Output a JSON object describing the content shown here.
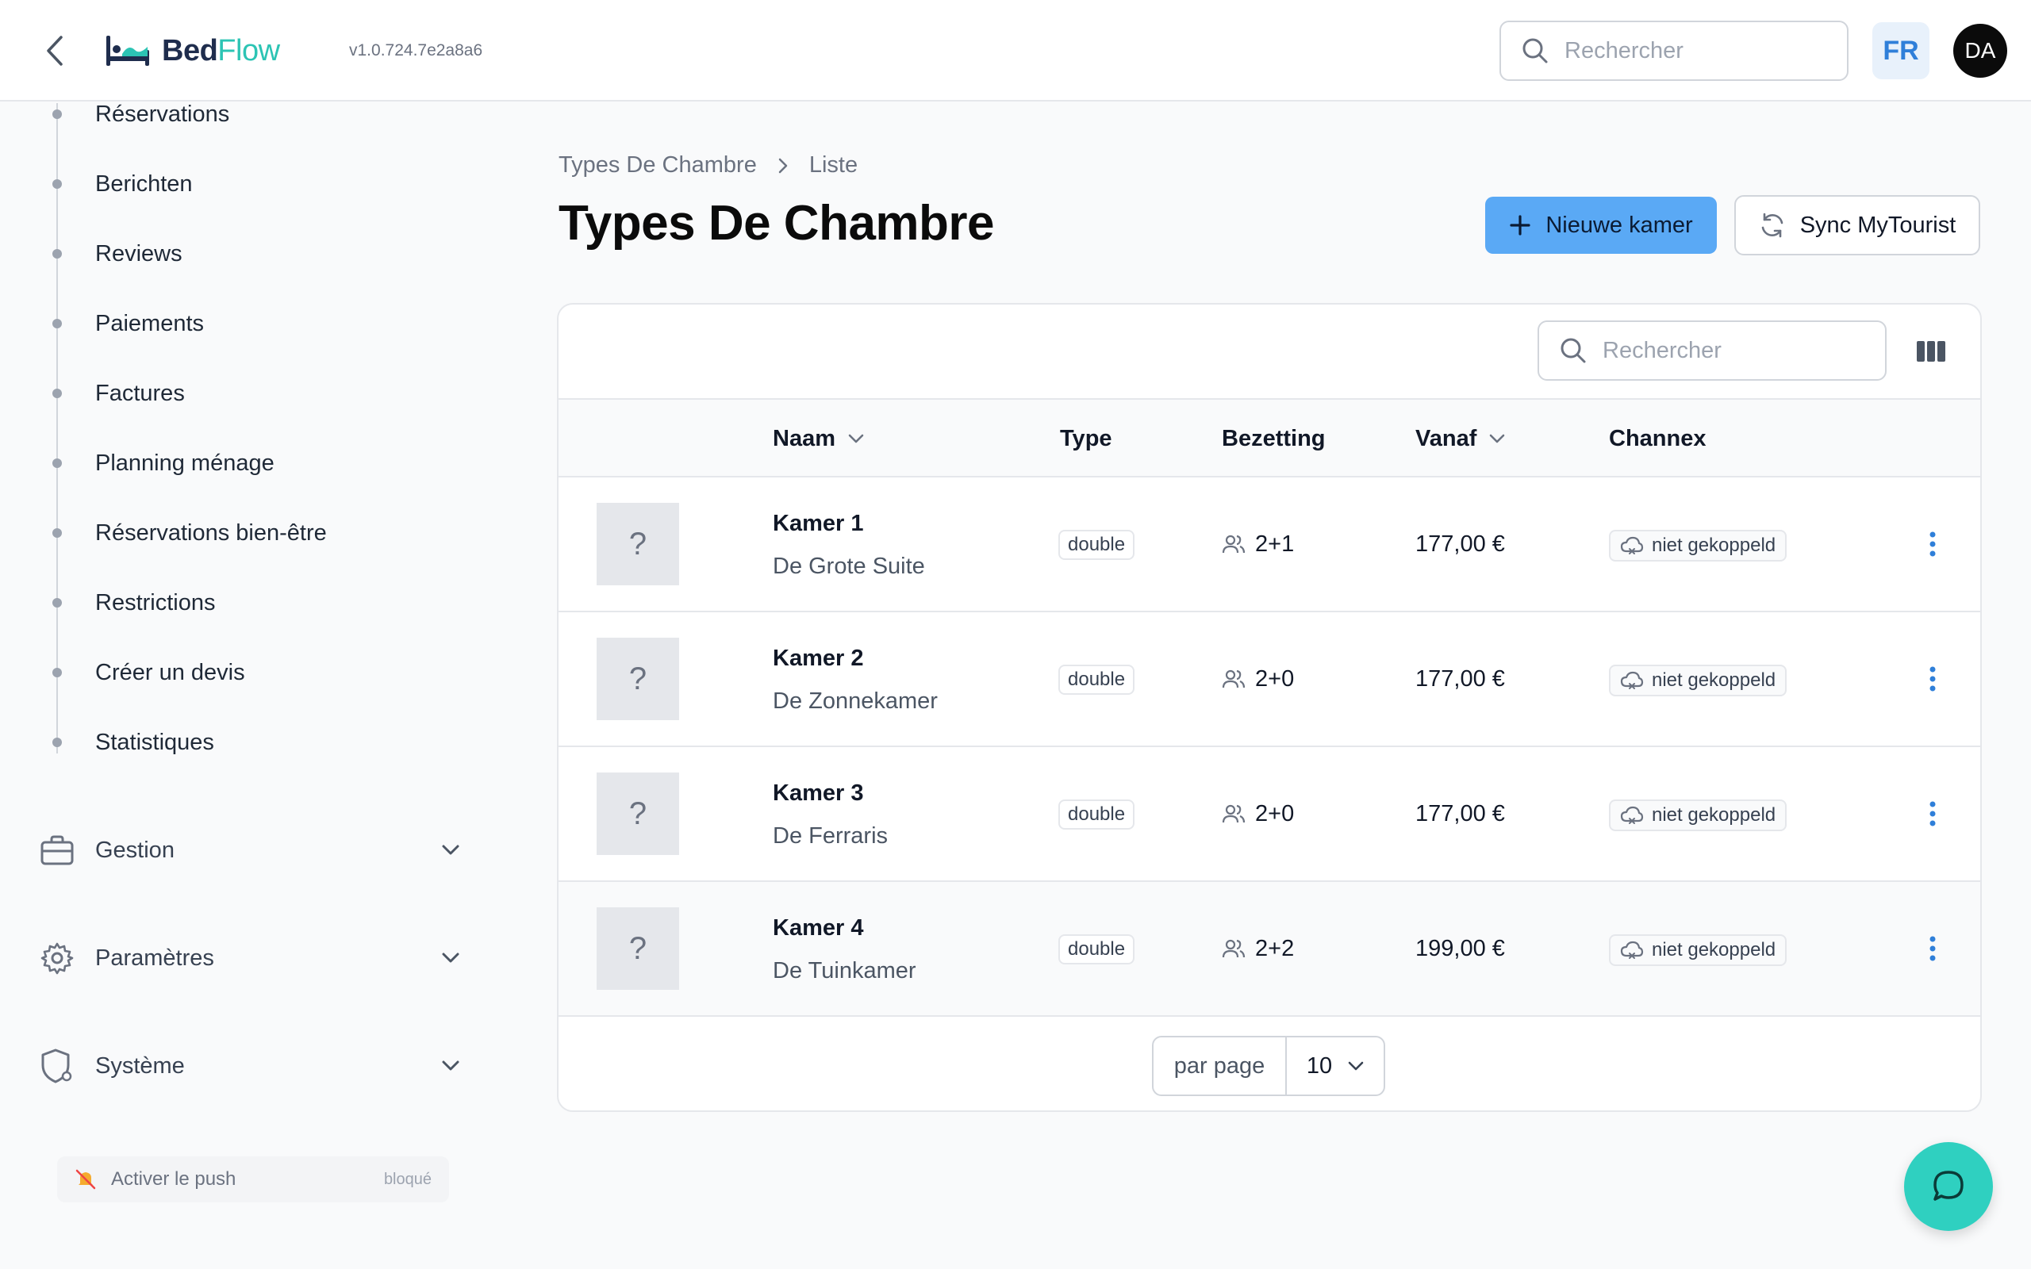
{
  "header": {
    "logo_bed": "Bed",
    "logo_flow": "Flow",
    "version": "v1.0.724.7e2a8a6",
    "search_placeholder": "Rechercher",
    "lang": "FR",
    "avatar_initials": "DA"
  },
  "sidebar": {
    "sub_items": [
      {
        "label": "Réservations"
      },
      {
        "label": "Berichten"
      },
      {
        "label": "Reviews"
      },
      {
        "label": "Paiements"
      },
      {
        "label": "Factures"
      },
      {
        "label": "Planning ménage"
      },
      {
        "label": "Réservations bien-être"
      },
      {
        "label": "Restrictions"
      },
      {
        "label": "Créer un devis"
      },
      {
        "label": "Statistiques"
      }
    ],
    "groups": [
      {
        "label": "Gestion",
        "icon": "briefcase-icon"
      },
      {
        "label": "Paramètres",
        "icon": "gear-icon"
      },
      {
        "label": "Système",
        "icon": "shield-gear-icon"
      }
    ],
    "push": {
      "label": "Activer le push",
      "status": "bloqué",
      "icon": "bell-off-icon"
    }
  },
  "main": {
    "breadcrumb": [
      "Types De Chambre",
      "Liste"
    ],
    "title": "Types De Chambre",
    "new_button": "Nieuwe kamer",
    "sync_button": "Sync MyTourist",
    "table_search_placeholder": "Rechercher",
    "columns": {
      "name": "Naam",
      "type": "Type",
      "occupancy": "Bezetting",
      "from": "Vanaf",
      "channex": "Channex"
    },
    "rows": [
      {
        "thumb": "?",
        "name": "Kamer 1",
        "subtitle": "De Grote Suite",
        "type": "double",
        "occupancy": "2+1",
        "price": "177,00 €",
        "channex": "niet gekoppeld"
      },
      {
        "thumb": "?",
        "name": "Kamer 2",
        "subtitle": "De Zonnekamer",
        "type": "double",
        "occupancy": "2+0",
        "price": "177,00 €",
        "channex": "niet gekoppeld"
      },
      {
        "thumb": "?",
        "name": "Kamer 3",
        "subtitle": "De Ferraris",
        "type": "double",
        "occupancy": "2+0",
        "price": "177,00 €",
        "channex": "niet gekoppeld"
      },
      {
        "thumb": "?",
        "name": "Kamer 4",
        "subtitle": "De Tuinkamer",
        "type": "double",
        "occupancy": "2+2",
        "price": "199,00 €",
        "channex": "niet gekoppeld"
      }
    ],
    "pagination": {
      "label": "par page",
      "value": "10"
    }
  },
  "colors": {
    "primary_button": "#5aa9f5",
    "accent_teal": "#2fd0c0",
    "kebab_blue": "#2f7fd9",
    "logo_navy": "#1f2d4d"
  }
}
